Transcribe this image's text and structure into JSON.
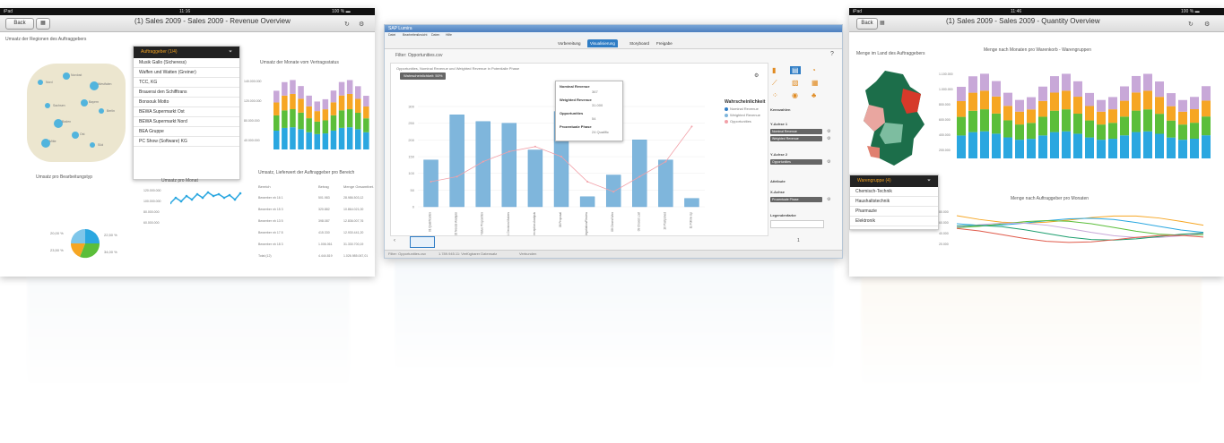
{
  "left_ipad": {
    "status_carrier": "iPad",
    "status_time": "11:16",
    "status_battery": "100 % ▬",
    "back_button": "Back",
    "title": "(1) Sales 2009 - Sales 2009 - Revenue Overview",
    "tile_map_title": "Umsatz der Regionen des Auftraggebers",
    "tile_pie_title": "Umsatz pro Bearbeitungstyp",
    "tile_line_title": "Umsatz pro Monat",
    "tile_stack_title": "Umsatz der Monate vom Vertragsstatus",
    "tile_table_title": "Umsatz, Lieferwert der Auftraggeber pro Bereich",
    "pie_labels": [
      "20,00 %",
      "23,50 %",
      "22,50 %",
      "34,00 %"
    ],
    "map_labels": [
      "Nord",
      "Nordost",
      "Westfalen",
      "Sachsen",
      "Bayern",
      "Baden",
      "Berlin",
      "Ost",
      "Mitte",
      "Süd"
    ],
    "popup_header": "Auftraggeber (1/4)",
    "popup_items": [
      "Musik Gallo (Sicheress)",
      "Waffen und Watten (Greiner)",
      "TCC, KG",
      "Brauerai den Schifftrans",
      "Bonsouk Motto",
      "BEWA Supermarkt Ost",
      "BEWA Supermarkt Nord",
      "BEA Gruppe",
      "PC Show (Software) KG"
    ],
    "table_headers": [
      "Bereich",
      "Betrag",
      "Menge Gesamtbet."
    ],
    "table_rows": [
      [
        "Bewerber nh 16 1",
        "501.983",
        "28.986.503,12"
      ],
      [
        "Bewerber nh 15 3",
        "320.882",
        "10.864.021,00"
      ],
      [
        "Bewerber nh 13 5",
        "398.087",
        "12.836.007,76"
      ],
      [
        "Bewerber nh 17 8",
        "415.330",
        "12.930.441,20"
      ],
      [
        "Bewerber nh 18 3",
        "1.006.061",
        "31.330.700,19"
      ],
      [
        "Total (12)",
        "4.444.819",
        "1.026.985.067,01"
      ]
    ],
    "stack_yticks": [
      "140.000.000",
      "120.000.000",
      "80.000.000",
      "40.000.000"
    ],
    "line_yticks": [
      "120.000.000",
      "100.000.000",
      "80.000.000",
      "60.000.000"
    ]
  },
  "center": {
    "window_title": "SAP Lumira",
    "menu": [
      "Datei",
      "Bearbeiten",
      "Ansicht",
      "Daten",
      "Hilfe"
    ],
    "tabs": [
      "Vorbereitung",
      "Visualisierung",
      "Storyboard",
      "Freigabe"
    ],
    "active_tab": "Visualisierung",
    "dataset_name": "Filter: Opportunities.csv",
    "chart_caption": "Opportunities, Nominal Revenue und Weighted Revenue in Potentialle Phase",
    "filter_chip": "Wahrscheinlichkeit: 50%",
    "legend_title": "Wahrscheinlichkeit",
    "legend_items": [
      "Nominal Revenue",
      "Weighted Revenue",
      "Opportunities"
    ],
    "tooltip_lines": [
      "Nominal Revenue",
      "Weighted Revenue",
      "Opportunities",
      "Prozentuale Phase"
    ],
    "tooltip_values": [
      "367",
      "31.000",
      "54",
      "24 Qualific"
    ],
    "right_panel_sections": [
      "Kennzahlen",
      "Y-Achse 1",
      "Y-Achse 2",
      "Attribute",
      "X-Achse",
      "Legendenfarbe"
    ],
    "right_panel_chips": [
      "Nominal Revenue",
      "Weighted Revenue",
      "Opportunities",
      "Prozentuale Phase"
    ],
    "status_items": [
      "Filter: Opportunities.csv",
      "1.789.945.11: Verfügbarer Datensatz",
      "Verbunden"
    ],
    "page_indicator": "1",
    "chart_data": {
      "type": "bar",
      "categories": [
        "01 Qualification",
        "02 Needs Analysis",
        "03 Value Proposition",
        "04 Id. Decision Makers",
        "05 Perception Analysis",
        "06 Proposal",
        "07 Negotiation/Review",
        "08 Closed Won",
        "09 Closed Lost",
        "10 Postponed",
        "11 Follow Up",
        "12 Final"
      ],
      "values": [
        140,
        275,
        255,
        250,
        170,
        285,
        30,
        95,
        200,
        140,
        25
      ],
      "line_values": [
        25,
        30,
        45,
        55,
        60,
        50,
        25,
        15,
        30,
        45,
        80
      ],
      "yticks": [
        "300",
        "250",
        "200",
        "150",
        "100",
        "50",
        "0"
      ],
      "ylim": [
        0,
        300
      ],
      "legend": "right"
    }
  },
  "right_ipad": {
    "status_carrier": "iPad",
    "status_time": "11:46",
    "status_battery": "100 % ▬",
    "back_button": "Back",
    "title": "(1) Sales 2009 - Sales 2009 - Quantity Overview",
    "tile_map_title": "Menge im Land des Auftraggebers",
    "tile_stack_title": "Menge nach Monaten pro Warenkorb - Warengruppen",
    "tile_line_title": "Menge nach Auftraggeber pro Monaten",
    "popup_header": "Warengruppe (4)",
    "popup_items": [
      "Chemisch-Technik",
      "Haushaltstechnik",
      "Pharmazie",
      "Elektronik"
    ],
    "stack_yticks": [
      "1.100.000",
      "1.000.000",
      "800.000",
      "600.000",
      "400.000",
      "200.000"
    ],
    "line_yticks": [
      "80.000",
      "60.000",
      "40.000",
      "20.000"
    ]
  },
  "colors": {
    "stack": [
      "#2aa7e0",
      "#5bbe3a",
      "#f6a623",
      "#c8a8d8"
    ],
    "bar": "#7fb6dc",
    "accent": "#2f7dc5",
    "line_pink": "#f2a0a8"
  }
}
